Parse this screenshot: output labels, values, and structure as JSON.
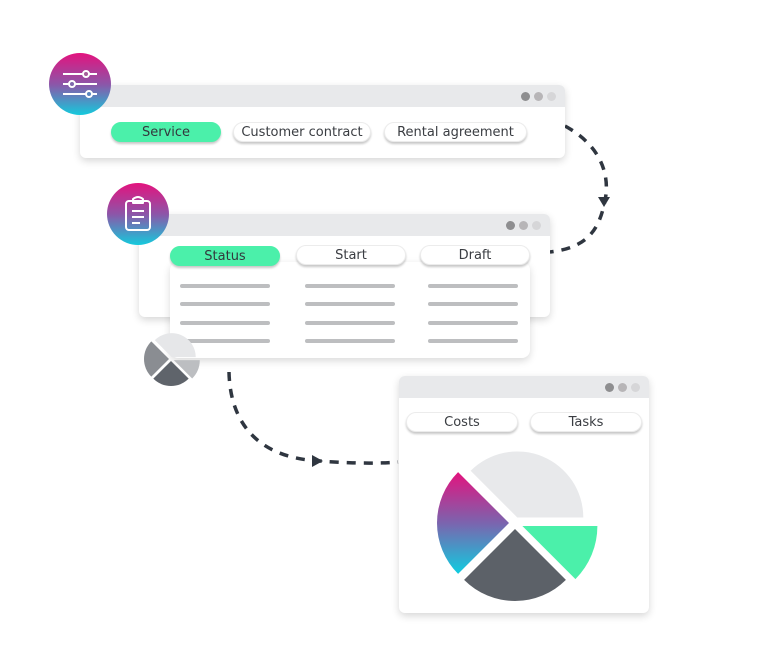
{
  "windows": {
    "filter_window": {
      "icon": "sliders-icon",
      "tabs": [
        {
          "label": "Service",
          "active": true
        },
        {
          "label": "Customer contract",
          "active": false
        },
        {
          "label": "Rental agreement",
          "active": false
        }
      ]
    },
    "status_window": {
      "icon": "clipboard-icon",
      "tabs": [
        {
          "label": "Status",
          "active": true
        },
        {
          "label": "Start",
          "active": false
        },
        {
          "label": "Draft",
          "active": false
        }
      ],
      "placeholder_rows": 4
    },
    "report_window": {
      "icon": "pie-chart-icon",
      "tabs": [
        {
          "label": "Costs",
          "active": false
        },
        {
          "label": "Tasks",
          "active": false
        }
      ]
    }
  },
  "colors": {
    "accent_green": "#4bf0aa",
    "gradient_top": "#e3137e",
    "gradient_bottom": "#14cadc",
    "dark_gray": "#5c6168",
    "light_gray": "#e8e9eb",
    "arrow": "#2f3640"
  },
  "pie_segments": [
    {
      "name": "light-gray-segment",
      "share": 0.375,
      "color": "#e8e9eb"
    },
    {
      "name": "green-segment",
      "share": 0.125,
      "color": "#4bf0aa"
    },
    {
      "name": "dark-gray-segment",
      "share": 0.25,
      "color": "#5c6168"
    },
    {
      "name": "gradient-segment",
      "share": 0.25,
      "color": "gradient"
    }
  ]
}
